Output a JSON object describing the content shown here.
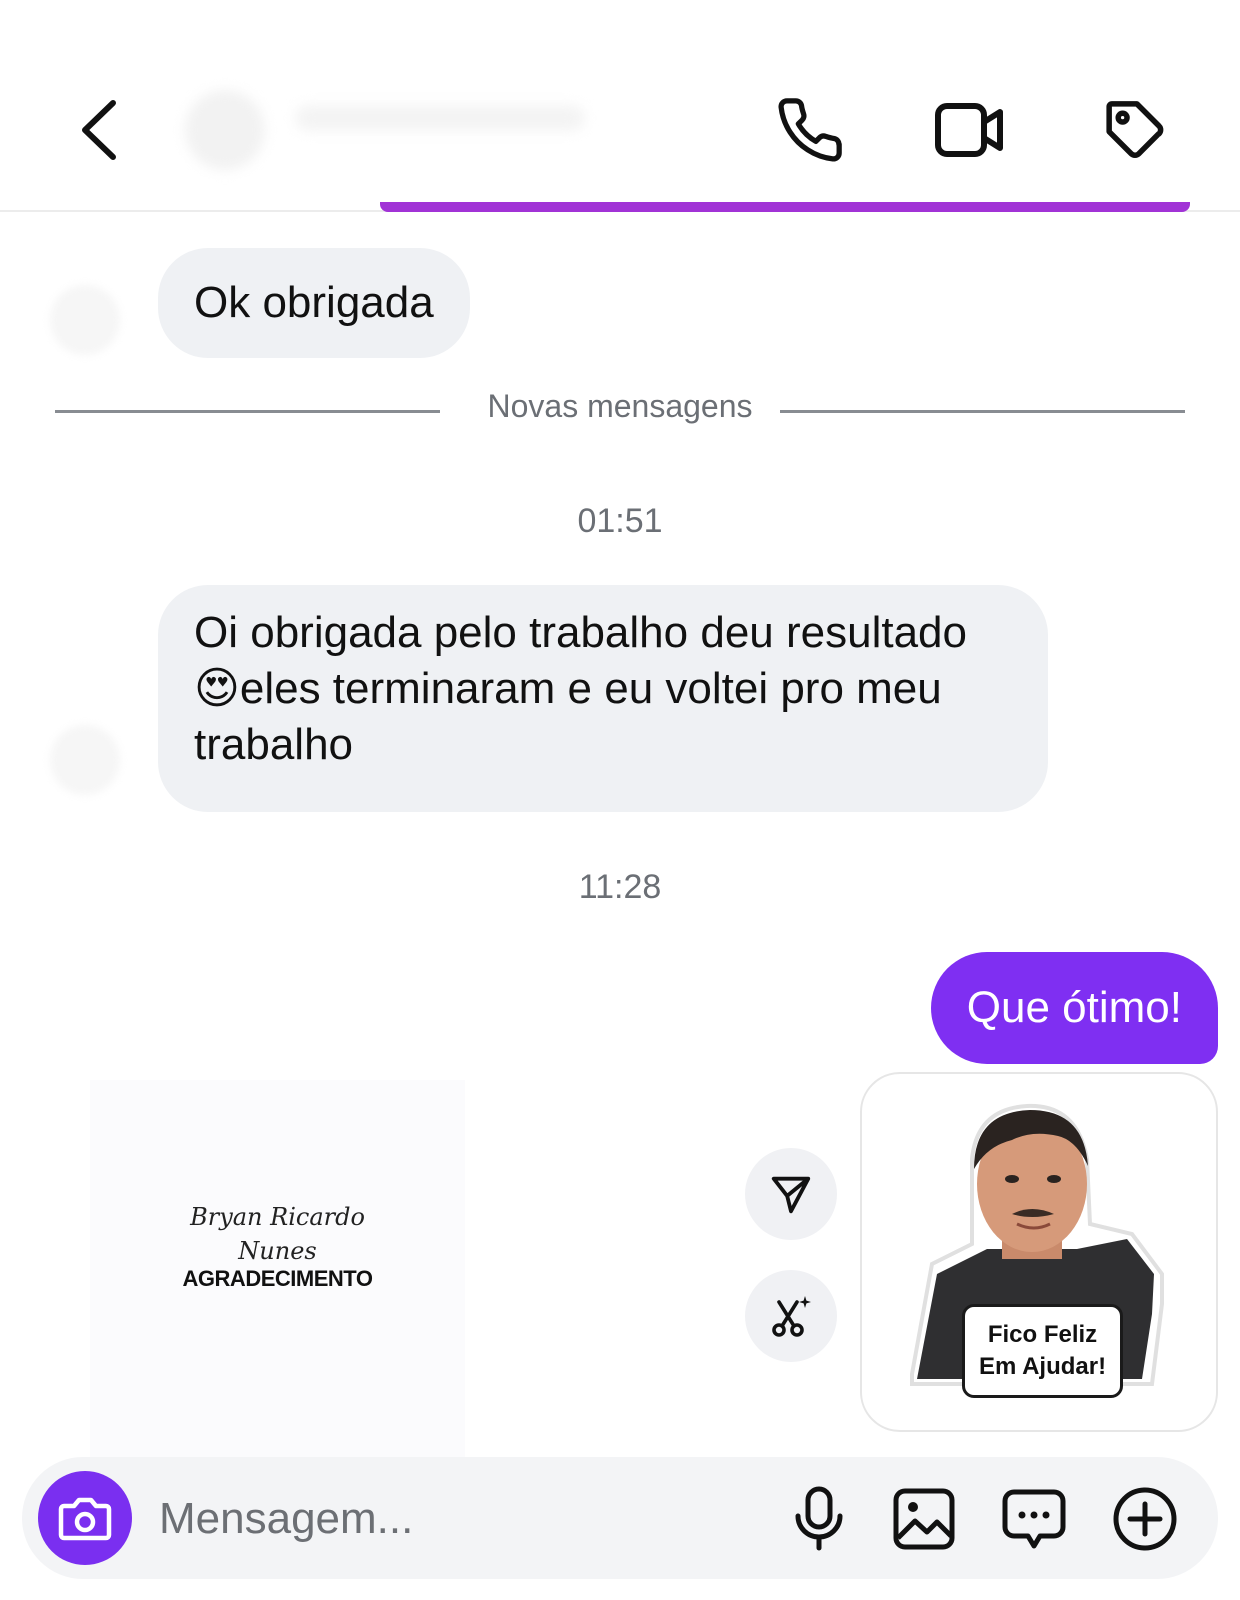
{
  "header": {
    "back_icon": "chevron-left-icon",
    "call_icon": "phone-icon",
    "video_icon": "video-camera-icon",
    "tag_icon": "tag-icon"
  },
  "messages": {
    "incoming_1": "Ok obrigada",
    "new_messages_divider": "Novas mensagens",
    "timestamp_1": "01:51",
    "incoming_2": "Oi obrigada pelo trabalho deu resultado 😍eles terminaram  e eu voltei pro meu trabalho",
    "incoming_2_emoji": "heart-eyes-emoji",
    "timestamp_2": "11:28",
    "outgoing_1": "Que ótimo!"
  },
  "thanks_card": {
    "signature_line_1": "Bryan Ricardo",
    "signature_line_2": "Nunes",
    "label": "AGRADECIMENTO"
  },
  "actions": {
    "forward_icon": "send-forward-icon",
    "ai_edit_icon": "scissors-sparkle-icon"
  },
  "sticker": {
    "caption_line_1": "Fico Feliz",
    "caption_line_2": "Em Ajudar!"
  },
  "composer": {
    "camera_icon": "camera-icon",
    "placeholder": "Mensagem...",
    "mic_icon": "microphone-icon",
    "gallery_icon": "image-icon",
    "sticker_icon": "chat-bubble-icon",
    "plus_icon": "plus-circle-icon"
  },
  "colors": {
    "accent": "#7f2ff2",
    "camera_button": "#7a2ff0",
    "incoming_bubble": "#eff1f4",
    "header_strip": "#a133d6",
    "muted_text": "#6b6f75"
  }
}
